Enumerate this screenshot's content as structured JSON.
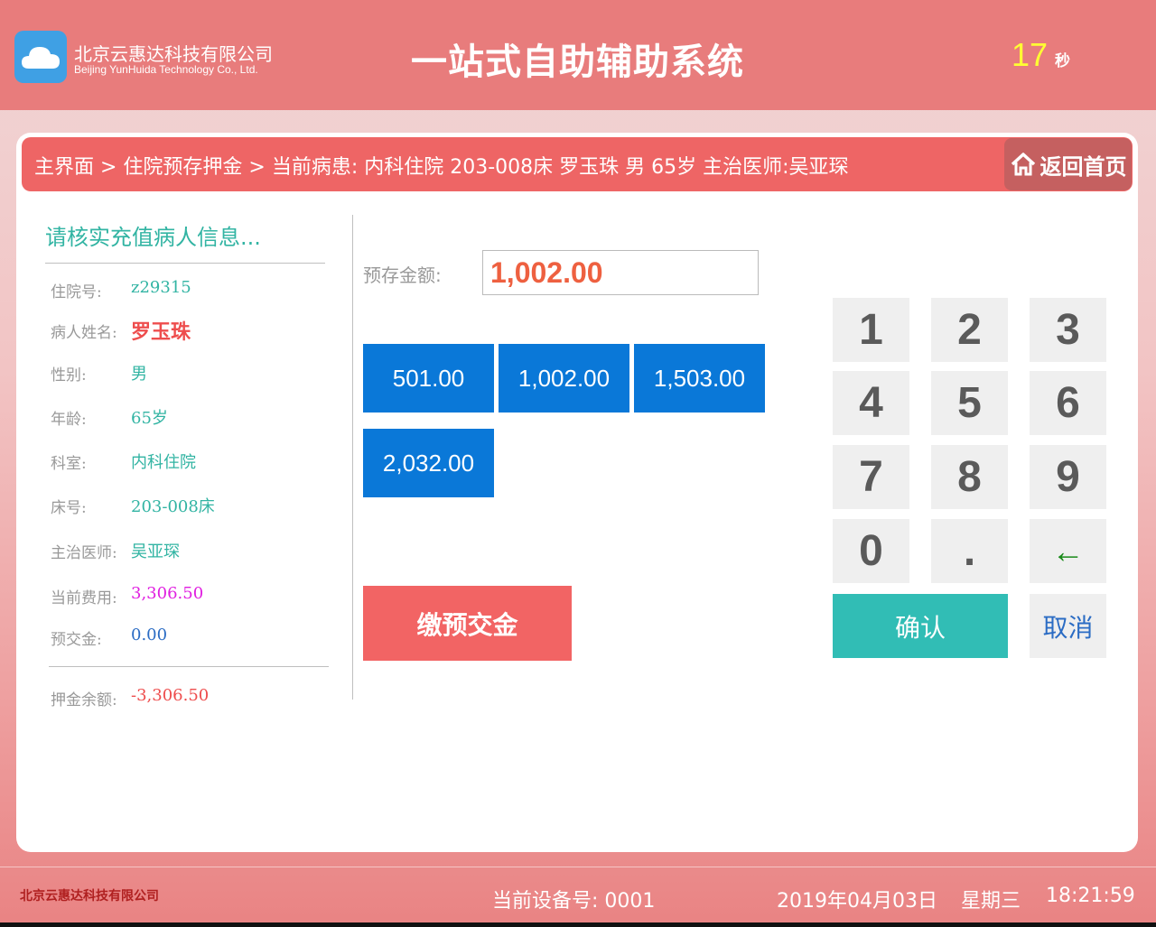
{
  "header": {
    "company_cn": "北京云惠达科技有限公司",
    "company_en": "Beijing YunHuida Technology Co., Ltd.",
    "title": "一站式自助辅助系统",
    "countdown": "17",
    "countdown_unit": "秒"
  },
  "breadcrumb": {
    "text": "主界面 > 住院预存押金 > 当前病患: 内科住院  203-008床  罗玉珠  男  65岁  主治医师:吴亚琛",
    "home_label": "返回首页"
  },
  "patient": {
    "heading": "请核实充值病人信息...",
    "fields": [
      {
        "label": "住院号:",
        "value": "z29315"
      },
      {
        "label": "病人姓名:",
        "value": "罗玉珠"
      },
      {
        "label": "性别:",
        "value": "男"
      },
      {
        "label": "年龄:",
        "value": "65岁"
      },
      {
        "label": "科室:",
        "value": "内科住院"
      },
      {
        "label": "床号:",
        "value": "203-008床"
      },
      {
        "label": "主治医师:",
        "value": "吴亚琛"
      },
      {
        "label": "当前费用:",
        "value": "3,306.50"
      },
      {
        "label": "预交金:",
        "value": "0.00"
      }
    ],
    "balance_label": "押金余额:",
    "balance_value": "-3,306.50"
  },
  "deposit": {
    "label": "预存金额:",
    "value": "1,002.00",
    "quick_amounts": [
      "501.00",
      "1,002.00",
      "1,503.00",
      "2,032.00"
    ],
    "pay_label": "缴预交金"
  },
  "keypad": {
    "keys": [
      "1",
      "2",
      "3",
      "4",
      "5",
      "6",
      "7",
      "8",
      "9",
      "0",
      ".",
      "←"
    ],
    "confirm_label": "确认",
    "cancel_label": "取消"
  },
  "footer": {
    "company": "北京云惠达科技有限公司",
    "device": "当前设备号: 0001",
    "date": "2019年04月03日",
    "weekday": "星期三",
    "time": "18:21:59"
  },
  "colors": {
    "header": "#e87c7c",
    "breadcrumb": "#ee6565",
    "quick_button": "#0a78d8",
    "confirm": "#31bdb5",
    "pay": "#f26464"
  }
}
